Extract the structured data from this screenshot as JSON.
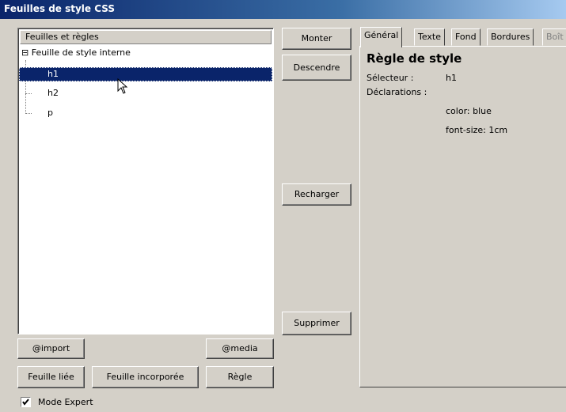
{
  "window": {
    "title": "Feuilles de style CSS"
  },
  "tree": {
    "header": "Feuilles et règles",
    "root": "Feuille de style interne",
    "expander": "⊟",
    "items": [
      {
        "label": "h1",
        "selected": true
      },
      {
        "label": "h2",
        "selected": false
      },
      {
        "label": "p",
        "selected": false
      }
    ]
  },
  "buttons": {
    "monter": "Monter",
    "descendre": "Descendre",
    "recharger": "Recharger",
    "supprimer": "Supprimer",
    "import": "@import",
    "media": "@media",
    "feuille_liee": "Feuille liée",
    "feuille_incorporee": "Feuille incorporée",
    "regle": "Règle"
  },
  "tabs": [
    "Général",
    "Texte",
    "Fond",
    "Bordures",
    "Boît"
  ],
  "active_tab": "Général",
  "general": {
    "heading": "Règle de style",
    "selector_label": "Sélecteur :",
    "selector_value": "h1",
    "declarations_label": "Déclarations :",
    "declarations": [
      "color: blue",
      "font-size: 1cm"
    ]
  },
  "expert_mode": {
    "label": "Mode Expert",
    "checked": true
  }
}
